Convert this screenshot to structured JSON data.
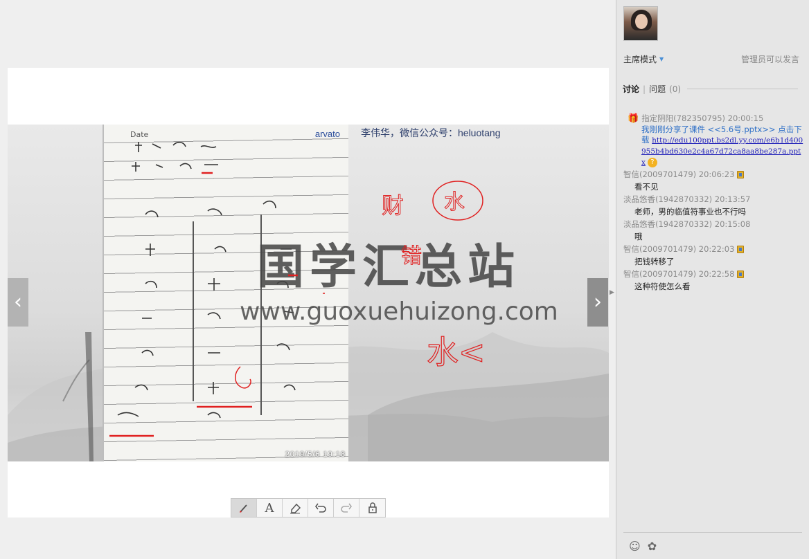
{
  "slide": {
    "caption": "李伟华，微信公众号：heluotang",
    "notebook_label": "Date",
    "notebook_brand": "arvato",
    "photo_timestamp": "2019/5/6  19:18",
    "watermark_title": "国学汇总站",
    "watermark_url": "www.guoxuehuizong.com",
    "annotation_text_1": "财",
    "annotation_text_2": "水",
    "annotation_text_3": "错",
    "annotation_text_4": "水<"
  },
  "navigation": {
    "prev": "‹",
    "next": "›"
  },
  "toolbar": {
    "tools": [
      "brush",
      "text",
      "eraser",
      "undo",
      "redo",
      "lock"
    ],
    "text_tool_label": "A"
  },
  "panel": {
    "mode": "主席模式",
    "mode_status": "管理员可以发言",
    "tab_discuss": "讨论",
    "tab_questions": "问题",
    "tab_questions_count": "(0)"
  },
  "messages": {
    "system": {
      "sender": "指定阴阳(782350795) 20:00:15",
      "text": "我刚刚分享了课件 <<5.6号.pptx>> 点击下载",
      "link": "http://edu100ppt.bs2dl.yy.com/e6b1d400955b4bd630e2c4a67d72ca8aa8be287a.pptx"
    },
    "list": [
      {
        "sender": "智信(2009701479) 20:06:23",
        "text": "看不见",
        "badge": true
      },
      {
        "sender": "淡品悠香(1942870332) 20:13:57",
        "text": "老师，男的临值符事业也不行吗",
        "badge": false
      },
      {
        "sender": "淡品悠香(1942870332) 20:15:08",
        "text": "哦",
        "badge": false
      },
      {
        "sender": "智信(2009701479) 20:22:03",
        "text": "把钱转移了",
        "badge": true
      },
      {
        "sender": "智信(2009701479) 20:22:58",
        "text": "这种符使怎么看",
        "badge": true
      }
    ]
  },
  "icons": {
    "gift": "gift-icon",
    "help": "?",
    "emoji": "emoji-icon",
    "settings": "settings-icon"
  },
  "colors": {
    "link": "#1d1db8",
    "system_text": "#2d6fc7",
    "annotation_red": "#e02020"
  }
}
